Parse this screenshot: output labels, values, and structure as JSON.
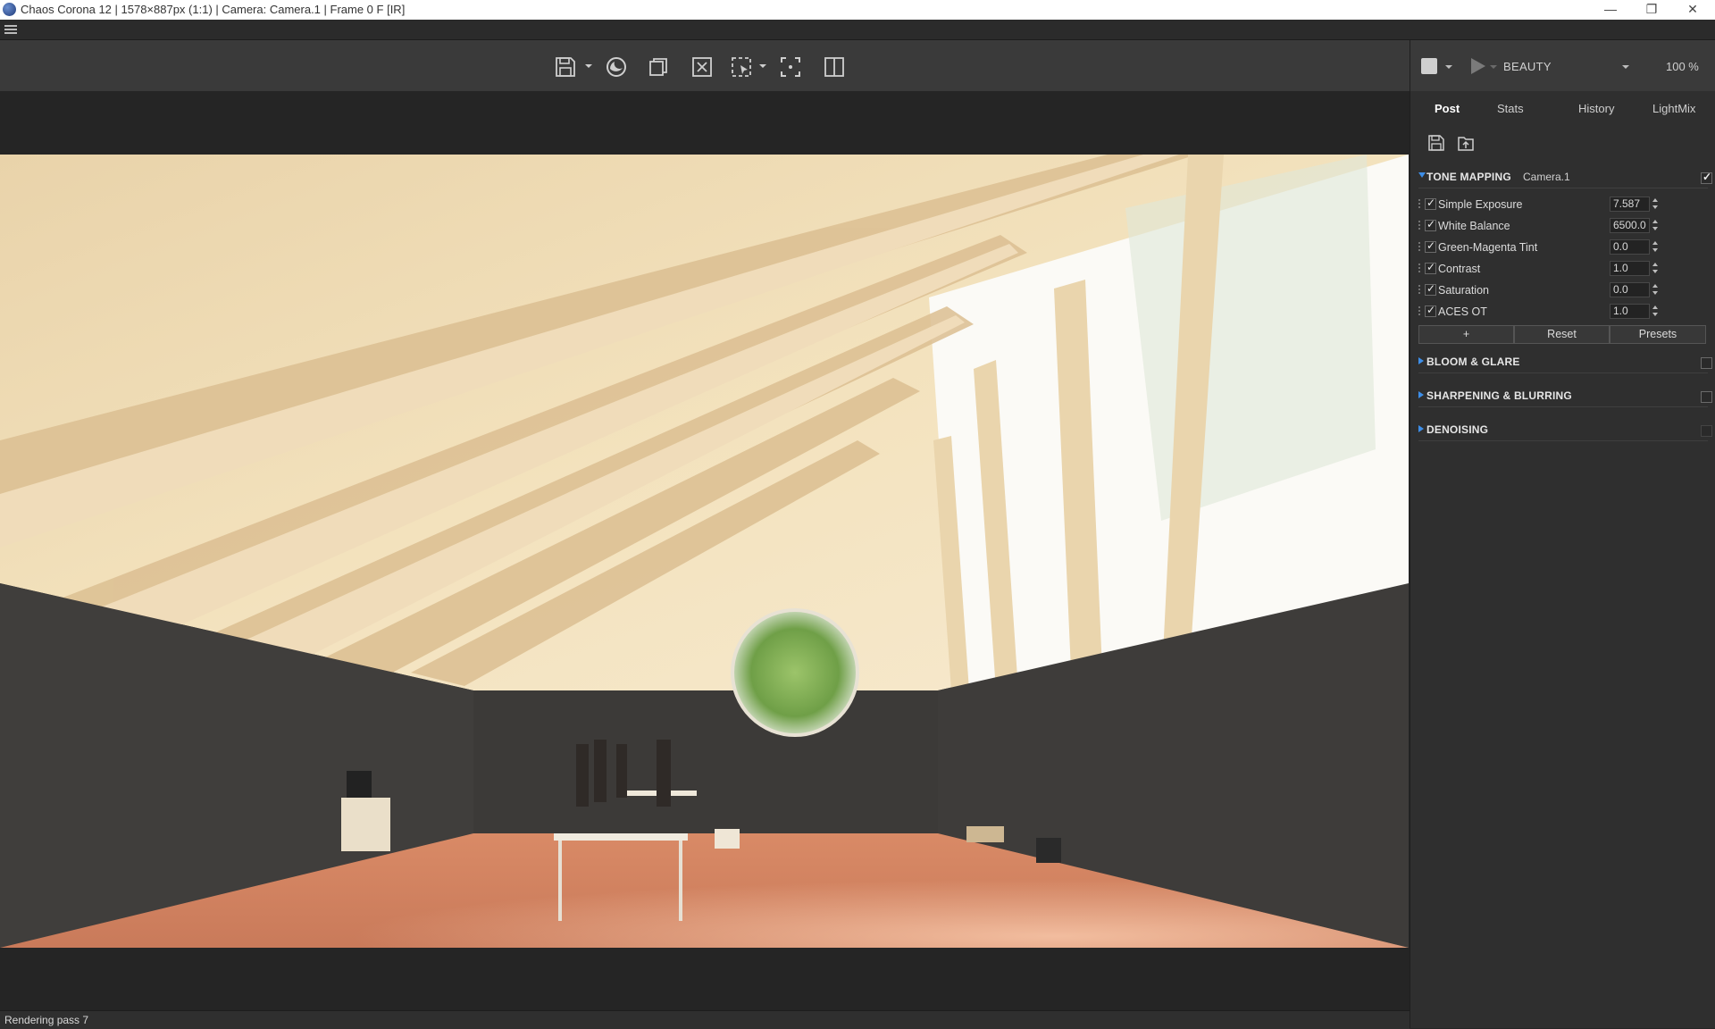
{
  "window": {
    "title": "Chaos Corona 12 | 1578×887px (1:1) | Camera: Camera.1 | Frame 0 F [IR]",
    "minimize": "—",
    "restore": "❐",
    "close": "✕"
  },
  "toolbar": {
    "icons": [
      "save-icon",
      "render-sphere-icon",
      "copy-icon",
      "clear-icon",
      "region-select-icon",
      "focus-icon",
      "split-compare-icon"
    ]
  },
  "render_controls": {
    "render_pass": "BEAUTY",
    "zoom": "100 %"
  },
  "panel": {
    "tabs": [
      "Post",
      "Stats",
      "History",
      "LightMix"
    ],
    "active_tab": "Post",
    "tone_mapping": {
      "title": "TONE MAPPING",
      "camera": "Camera.1",
      "enabled": true,
      "operators": [
        {
          "name": "Simple Exposure",
          "value": "7.587",
          "enabled": true
        },
        {
          "name": "White Balance",
          "value": "6500.0",
          "enabled": true
        },
        {
          "name": "Green-Magenta Tint",
          "value": "0.0",
          "enabled": true
        },
        {
          "name": "Contrast",
          "value": "1.0",
          "enabled": true
        },
        {
          "name": "Saturation",
          "value": "0.0",
          "enabled": true
        },
        {
          "name": "ACES OT",
          "value": "1.0",
          "enabled": true
        }
      ],
      "add_label": "+",
      "reset_label": "Reset",
      "presets_label": "Presets"
    },
    "sections": [
      {
        "title": "BLOOM & GLARE",
        "enabled": false
      },
      {
        "title": "SHARPENING & BLURRING",
        "enabled": false
      },
      {
        "title": "DENOISING",
        "enabled": false
      }
    ]
  },
  "status": {
    "text": "Rendering pass 7"
  },
  "colors": {
    "accent": "#3d8ee8",
    "panel_bg": "#2f2f2f",
    "toolbar_bg": "#3a3a3a"
  }
}
